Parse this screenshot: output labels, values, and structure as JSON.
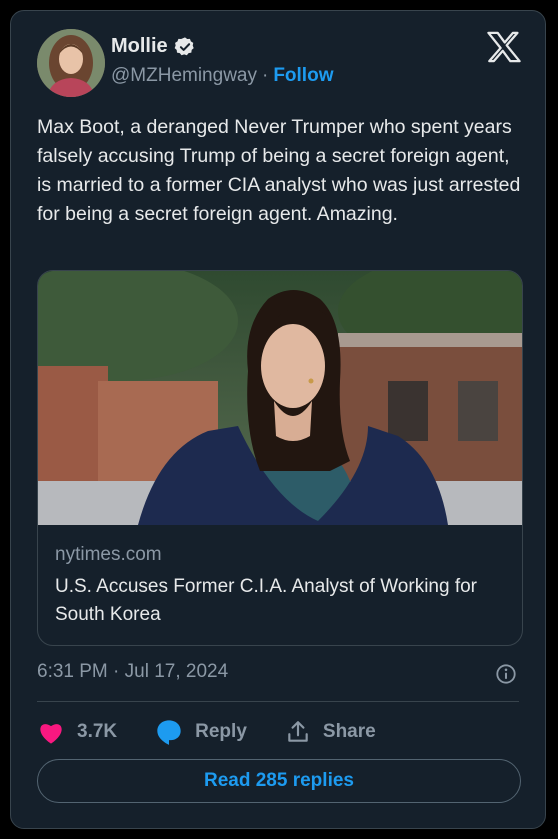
{
  "author": {
    "display_name": "Mollie",
    "handle": "@MZHemingway",
    "separator": "·",
    "follow_label": "Follow"
  },
  "tweet": {
    "text": "Max Boot, a deranged Never Trumper who spent years falsely accusing Trump of being a secret foreign agent, is married to a former CIA analyst who was just arrested for being a secret foreign agent. Amazing."
  },
  "link_card": {
    "domain": "nytimes.com",
    "headline": "U.S. Accuses Former C.I.A. Analyst of Working for South Korea"
  },
  "meta": {
    "timestamp": "6:31 PM · Jul 17, 2024"
  },
  "actions": {
    "like_count": "3.7K",
    "reply_label": "Reply",
    "share_label": "Share"
  },
  "read_replies_label": "Read 285 replies",
  "colors": {
    "background": "#15202b",
    "accent": "#1d9bf0",
    "like": "#f91880",
    "muted": "#8b98a5"
  },
  "icons": [
    "verified-badge-icon",
    "x-logo-icon",
    "info-icon",
    "heart-icon",
    "reply-bubble-icon",
    "share-icon"
  ]
}
